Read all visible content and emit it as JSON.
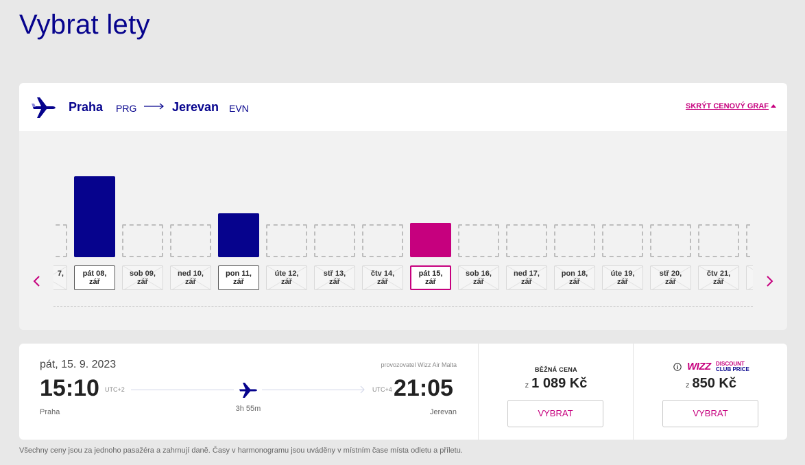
{
  "page": {
    "title": "Vybrat lety"
  },
  "route": {
    "from_city": "Praha",
    "from_code": "PRG",
    "to_city": "Jerevan",
    "to_code": "EVN",
    "hide_chart_label": "SKRÝT CENOVÝ GRAF"
  },
  "price_chart": {
    "selected_index": 8,
    "max_price": 1.0,
    "days": [
      {
        "label1": "",
        "label2": "",
        "partial_label": "7,",
        "status": "na",
        "level": 0
      },
      {
        "label1": "pát 08,",
        "label2": "zář",
        "status": "avail",
        "level": 1.0
      },
      {
        "label1": "sob 09,",
        "label2": "zář",
        "status": "na",
        "level": 0
      },
      {
        "label1": "ned 10,",
        "label2": "zář",
        "status": "na",
        "level": 0
      },
      {
        "label1": "pon 11,",
        "label2": "zář",
        "status": "avail",
        "level": 0.54
      },
      {
        "label1": "úte 12,",
        "label2": "zář",
        "status": "na",
        "level": 0
      },
      {
        "label1": "stř 13,",
        "label2": "zář",
        "status": "na",
        "level": 0
      },
      {
        "label1": "čtv 14,",
        "label2": "zář",
        "status": "na",
        "level": 0
      },
      {
        "label1": "pát 15,",
        "label2": "zář",
        "status": "selected",
        "level": 0.42
      },
      {
        "label1": "sob 16,",
        "label2": "zář",
        "status": "na",
        "level": 0
      },
      {
        "label1": "ned 17,",
        "label2": "zář",
        "status": "na",
        "level": 0
      },
      {
        "label1": "pon 18,",
        "label2": "zář",
        "status": "na",
        "level": 0
      },
      {
        "label1": "úte 19,",
        "label2": "zář",
        "status": "na",
        "level": 0
      },
      {
        "label1": "stř 20,",
        "label2": "zář",
        "status": "na",
        "level": 0
      },
      {
        "label1": "čtv 21,",
        "label2": "zář",
        "status": "na",
        "level": 0
      },
      {
        "label1": "",
        "label2": "",
        "status": "na",
        "level": 0
      }
    ],
    "colors": {
      "available": "#06038d",
      "selected": "#c6007e"
    }
  },
  "flight": {
    "date": "pát, 15. 9. 2023",
    "operator": "provozovatel Wizz Air Malta",
    "departure_time": "15:10",
    "departure_utc": "UTC+2",
    "departure_city": "Praha",
    "arrival_time": "21:05",
    "arrival_utc": "UTC+4",
    "arrival_city": "Jerevan",
    "duration": "3h 55m"
  },
  "fares": {
    "regular": {
      "label": "BĚŽNÁ CENA",
      "prefix": "z",
      "price": "1 089 Kč",
      "button": "VYBRAT"
    },
    "club": {
      "logo_word": "WIZZ",
      "logo_line1": "DISCOUNT",
      "logo_line2": "CLUB PRICE",
      "prefix": "z",
      "price": "850 Kč",
      "button": "VYBRAT"
    }
  },
  "footnote": "Všechny ceny jsou za jednoho pasažéra a zahrnují daně. Časy v harmonogramu jsou uváděny v místním čase místa odletu a příletu.",
  "theme": {
    "brand_blue": "#06038d",
    "brand_magenta": "#c6007e"
  }
}
